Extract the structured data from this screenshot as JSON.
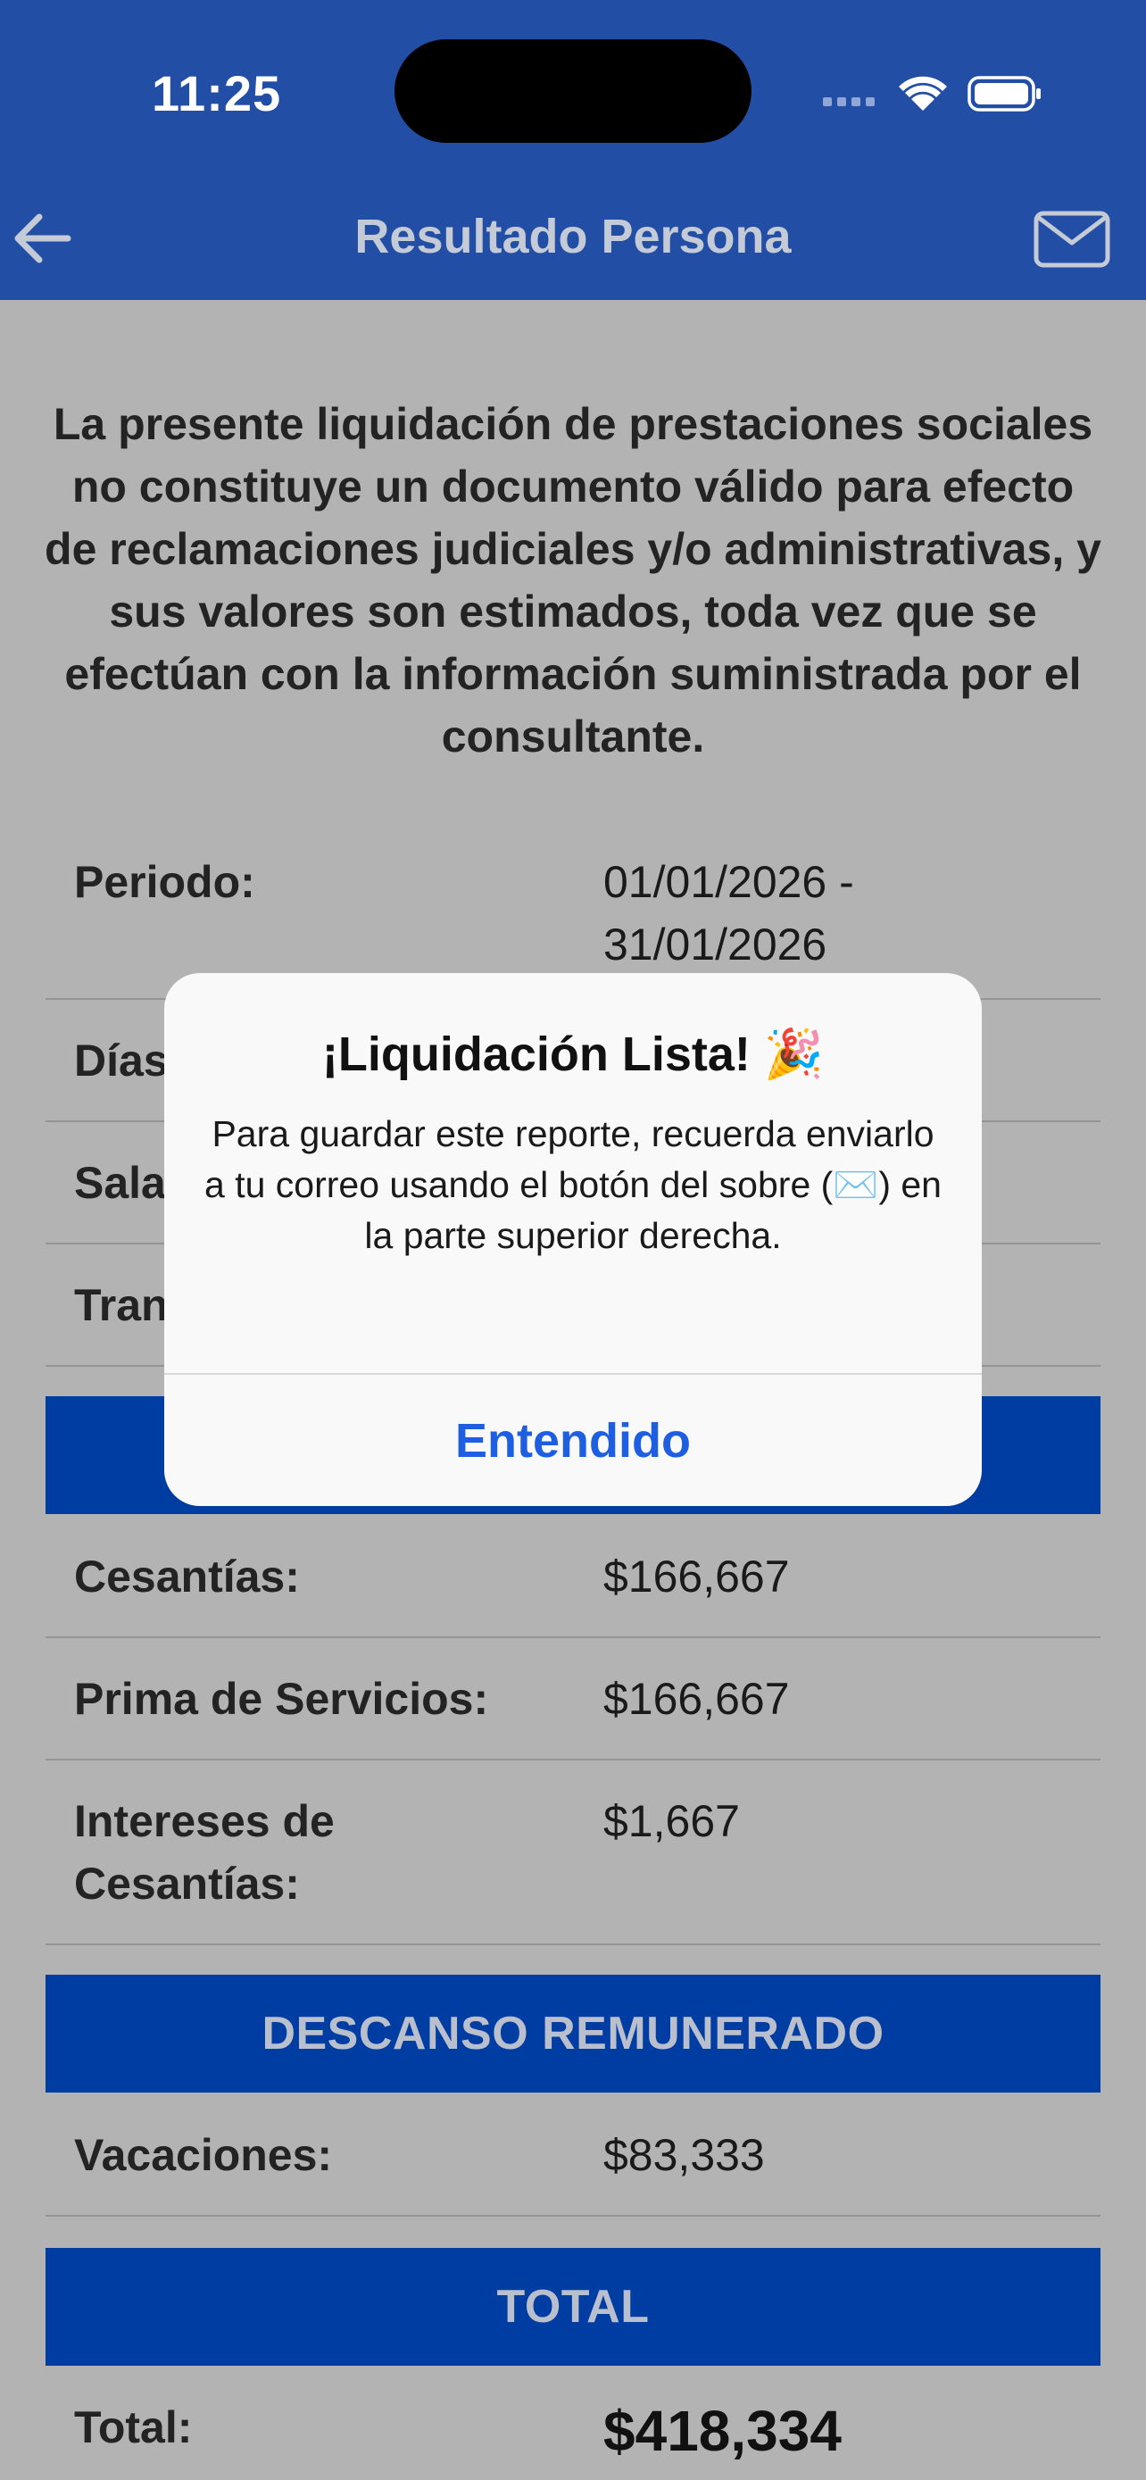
{
  "status_bar": {
    "time": "11:25"
  },
  "nav": {
    "title": "Resultado Persona"
  },
  "disclaimer": "La presente liquidación de prestaciones sociales no constituye un documento válido para efecto de reclamaciones judiciales y/o administrativas, y sus valores son estimados, toda vez que se efectúan con la información suministrada por el consultante.",
  "info_rows": [
    {
      "label": "Periodo:",
      "value_line1": "01/01/2026 -",
      "value_line2": "31/01/2026"
    },
    {
      "label": "Días"
    },
    {
      "label": "Sala"
    },
    {
      "label": "Tran"
    }
  ],
  "prestaciones": [
    {
      "label": "Cesantías:",
      "value": "$166,667"
    },
    {
      "label": "Prima de Servicios:",
      "value": "$166,667"
    },
    {
      "label_line1": "Intereses de",
      "label_line2": "Cesantías:",
      "value": "$1,667"
    }
  ],
  "sections": {
    "descanso": "DESCANSO REMUNERADO",
    "total": "TOTAL"
  },
  "descanso_rows": [
    {
      "label": "Vacaciones:",
      "value": "$83,333"
    }
  ],
  "total_row": {
    "label": "Total:",
    "value": "$418,334"
  },
  "alert": {
    "title": "¡Liquidación Lista! 🎉",
    "message": "Para guardar este reporte, recuerda enviarlo a tu correo usando el botón del sobre (✉️) en la parte superior derecha.",
    "button": "Entendido"
  },
  "colors": {
    "header": "#224ea5",
    "section_header": "#003da2",
    "overlay_background": "#b3b3b3",
    "alert_button": "#1d5fe0"
  }
}
